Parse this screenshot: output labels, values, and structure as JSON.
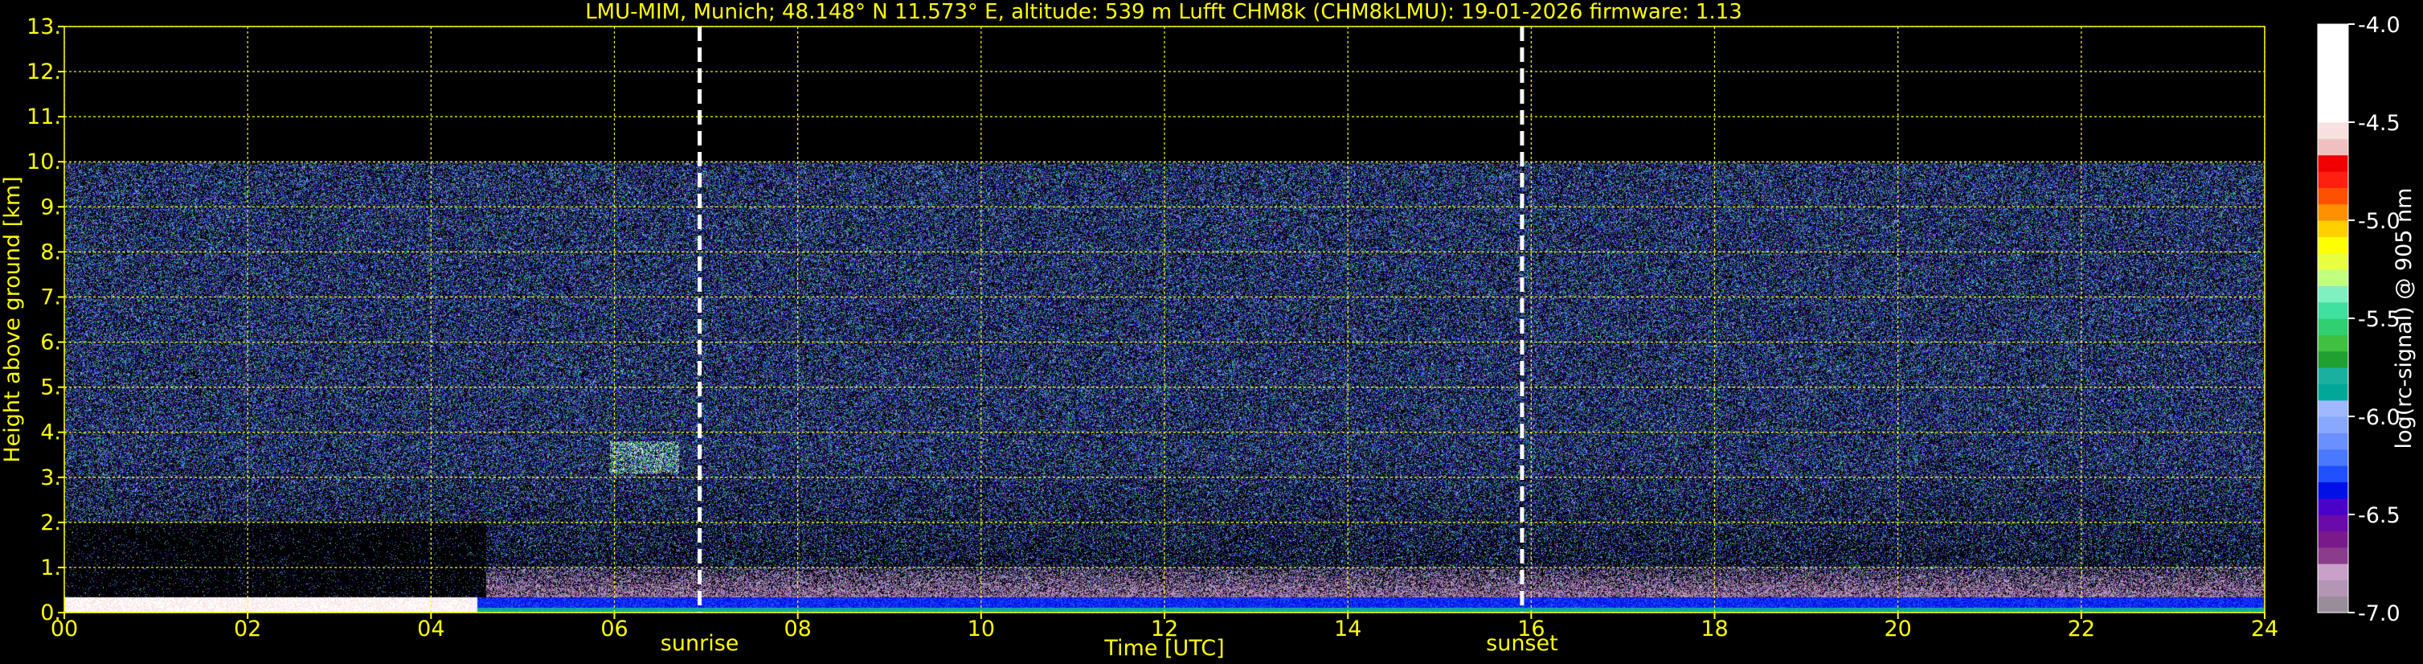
{
  "chart_data": {
    "type": "heatmap",
    "title": "LMU-MIM, Munich; 48.148° N 11.573° E, altitude: 539 m    Lufft CHM8k (CHM8kLMU): 19-01-2026    firmware: 1.13",
    "xlabel": "Time [UTC]",
    "ylabel": "Height above ground [km]",
    "xlim": [
      0,
      24
    ],
    "ylim": [
      0,
      13
    ],
    "x_ticks": [
      "00",
      "02",
      "04",
      "06",
      "08",
      "10",
      "12",
      "14",
      "16",
      "18",
      "20",
      "22",
      "24"
    ],
    "y_ticks": [
      "0.",
      "1.",
      "2.",
      "3.",
      "4.",
      "5.",
      "6.",
      "7.",
      "8.",
      "9.",
      "10.",
      "11.",
      "12.",
      "13."
    ],
    "grid": true,
    "data_top_km": 10.0,
    "events": [
      {
        "label": "sunrise",
        "time_utc": 6.93
      },
      {
        "label": "sunset",
        "time_utc": 15.9
      }
    ],
    "features": [
      {
        "kind": "cloud",
        "time_start_utc": 5.95,
        "time_end_utc": 6.7,
        "height_min_km": 3.1,
        "height_max_km": 3.8
      },
      {
        "kind": "surface-layer",
        "time_start_utc": 0.0,
        "time_end_utc": 24.0,
        "height_min_km": 0.0,
        "height_max_km": 0.35
      },
      {
        "kind": "boundary-layer",
        "time_start_utc": 4.6,
        "time_end_utc": 24.0,
        "height_min_km": 0.0,
        "height_max_km": 1.0
      }
    ],
    "colorbar": {
      "label": "log(rc-signal) @ 905 nm",
      "ticks": [
        "-4.0",
        "-4.5",
        "-5.0",
        "-5.5",
        "-6.0",
        "-6.5",
        "-7.0"
      ],
      "range": [
        -7.0,
        -4.0
      ],
      "colors": [
        "#9a8d9a",
        "#b496b4",
        "#c8a0c8",
        "#8c3c8c",
        "#7a1a8a",
        "#6a0aaa",
        "#4a00c8",
        "#0010e6",
        "#2050ff",
        "#4a78ff",
        "#6a90ff",
        "#88a8ff",
        "#a0b8ff",
        "#00a89a",
        "#1ab0a0",
        "#20a030",
        "#40c040",
        "#30d070",
        "#40e0a0",
        "#80f0c0",
        "#c0ff80",
        "#e8ff40",
        "#ffff00",
        "#ffd000",
        "#ff9000",
        "#ff5000",
        "#ff2010",
        "#f00000",
        "#f0c0c0",
        "#f8e0e0",
        "#ffffff",
        "#ffffff",
        "#ffffff",
        "#ffffff",
        "#ffffff",
        "#ffffff"
      ]
    }
  }
}
